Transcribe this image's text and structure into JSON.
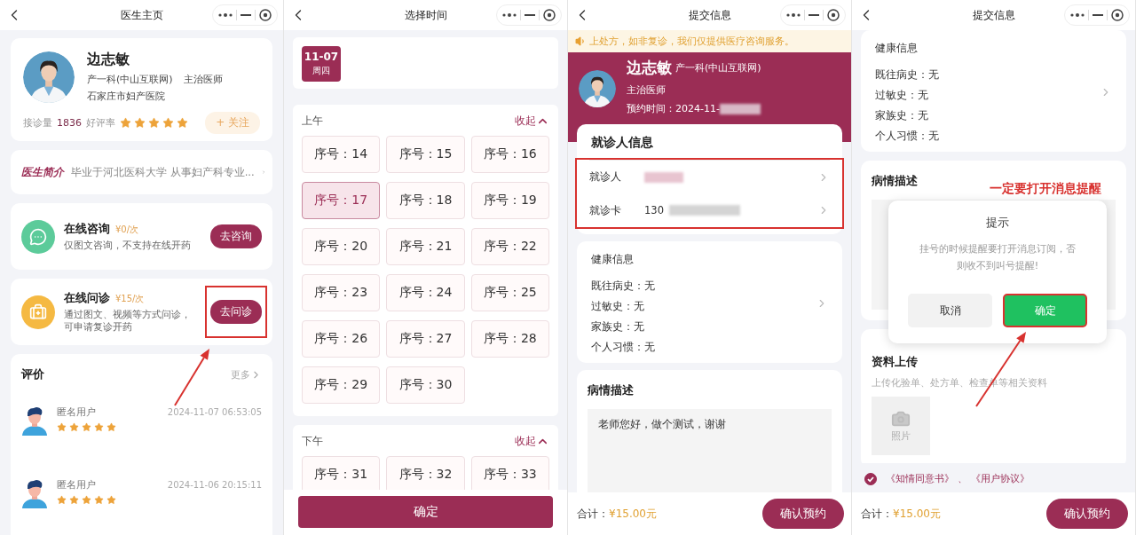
{
  "doctor_home": {
    "title": "医生主页",
    "doctor": {
      "name": "边志敏",
      "department": "产一科(中山互联网)",
      "rank": "主治医师",
      "hospital": "石家庄市妇产医院",
      "visits_label": "接诊量",
      "visits": "1836",
      "rating_label": "好评率",
      "stars": 5,
      "follow_button": "+ 关注"
    },
    "intro": {
      "label": "医生简介",
      "text": "毕业于河北医科大学 从事妇产科专业..."
    },
    "services": [
      {
        "kind": "chat",
        "name": "在线咨询",
        "price": "¥0/次",
        "description": "仅图文咨询，不支持在线开药",
        "button": "去咨询",
        "annotated": false
      },
      {
        "kind": "kit",
        "name": "在线问诊",
        "price": "¥15/次",
        "description": "通过图文、视频等方式问诊，可申请复诊开药",
        "button": "去问诊",
        "annotated": true
      }
    ],
    "reviews": {
      "title": "评价",
      "more": "更多",
      "items": [
        {
          "user": "匿名用户",
          "time": "2024-11-07 06:53:05",
          "stars": 5
        },
        {
          "user": "匿名用户",
          "time": "2024-11-06 20:15:11",
          "stars": 5
        }
      ]
    }
  },
  "select_time": {
    "title": "选择时间",
    "dates": [
      {
        "date": "11-07",
        "weekday": "周四",
        "selected": true
      }
    ],
    "sections": [
      {
        "title": "上午",
        "toggle": "收起",
        "slots": [
          {
            "label": "序号：14",
            "selected": false
          },
          {
            "label": "序号：15",
            "selected": false
          },
          {
            "label": "序号：16",
            "selected": false
          },
          {
            "label": "序号：17",
            "selected": true
          },
          {
            "label": "序号：18",
            "selected": false
          },
          {
            "label": "序号：19",
            "selected": false
          },
          {
            "label": "序号：20",
            "selected": false
          },
          {
            "label": "序号：21",
            "selected": false
          },
          {
            "label": "序号：22",
            "selected": false
          },
          {
            "label": "序号：23",
            "selected": false
          },
          {
            "label": "序号：24",
            "selected": false
          },
          {
            "label": "序号：25",
            "selected": false
          },
          {
            "label": "序号：26",
            "selected": false
          },
          {
            "label": "序号：27",
            "selected": false
          },
          {
            "label": "序号：28",
            "selected": false
          },
          {
            "label": "序号：29",
            "selected": false
          },
          {
            "label": "序号：30",
            "selected": false
          }
        ]
      },
      {
        "title": "下午",
        "toggle": "收起",
        "slots": [
          {
            "label": "序号：31",
            "selected": false
          },
          {
            "label": "序号：32",
            "selected": false
          },
          {
            "label": "序号：33",
            "selected": false
          }
        ]
      }
    ],
    "confirm_button": "确定"
  },
  "submit_info": {
    "title": "提交信息",
    "notice": "上处方，如非复诊，我们仅提供医疗咨询服务。",
    "doctor": {
      "name": "边志敏",
      "department": "产一科(中山互联网)",
      "rank": "主治医师",
      "appointment": "预约时间：2024-11-"
    },
    "patient": {
      "title": "就诊人信息",
      "annotated": true,
      "rows": [
        {
          "label": "就诊人",
          "kind": "blurred"
        },
        {
          "label": "就诊卡",
          "kind": "partial",
          "value": "130"
        }
      ]
    },
    "health": {
      "title": "健康信息",
      "items": [
        "既往病史：无",
        "过敏史：无",
        "家族史：无",
        "个人习惯：无"
      ]
    },
    "description": {
      "title": "病情描述",
      "text": "老师您好，做个测试，谢谢"
    },
    "footer": {
      "total_label": "合计：",
      "total": "¥15.00元",
      "button": "确认预约"
    }
  },
  "submit_dialog": {
    "title": "提交信息",
    "health": {
      "title": "健康信息",
      "items": [
        "既往病史：无",
        "过敏史：无",
        "家族史：无",
        "个人习惯：无"
      ]
    },
    "description": {
      "title": "病情描述"
    },
    "dialog": {
      "annotation": "一定要打开消息提醒",
      "title": "提示",
      "message": "挂号的时候提醒要打开消息订阅，否则收不到叫号提醒!",
      "cancel": "取消",
      "confirm": "确定",
      "confirm_annotated": true
    },
    "upload": {
      "title": "资料上传",
      "hint": "上传化验单、处方单、检查单等相关资料",
      "photo_label": "照片"
    },
    "agreement": {
      "checked": true,
      "links": [
        "《知情同意书》",
        "《用户协议》"
      ],
      "separator": "、"
    },
    "footer": {
      "total_label": "合计：",
      "total": "¥15.00元",
      "button": "确认预约"
    }
  }
}
